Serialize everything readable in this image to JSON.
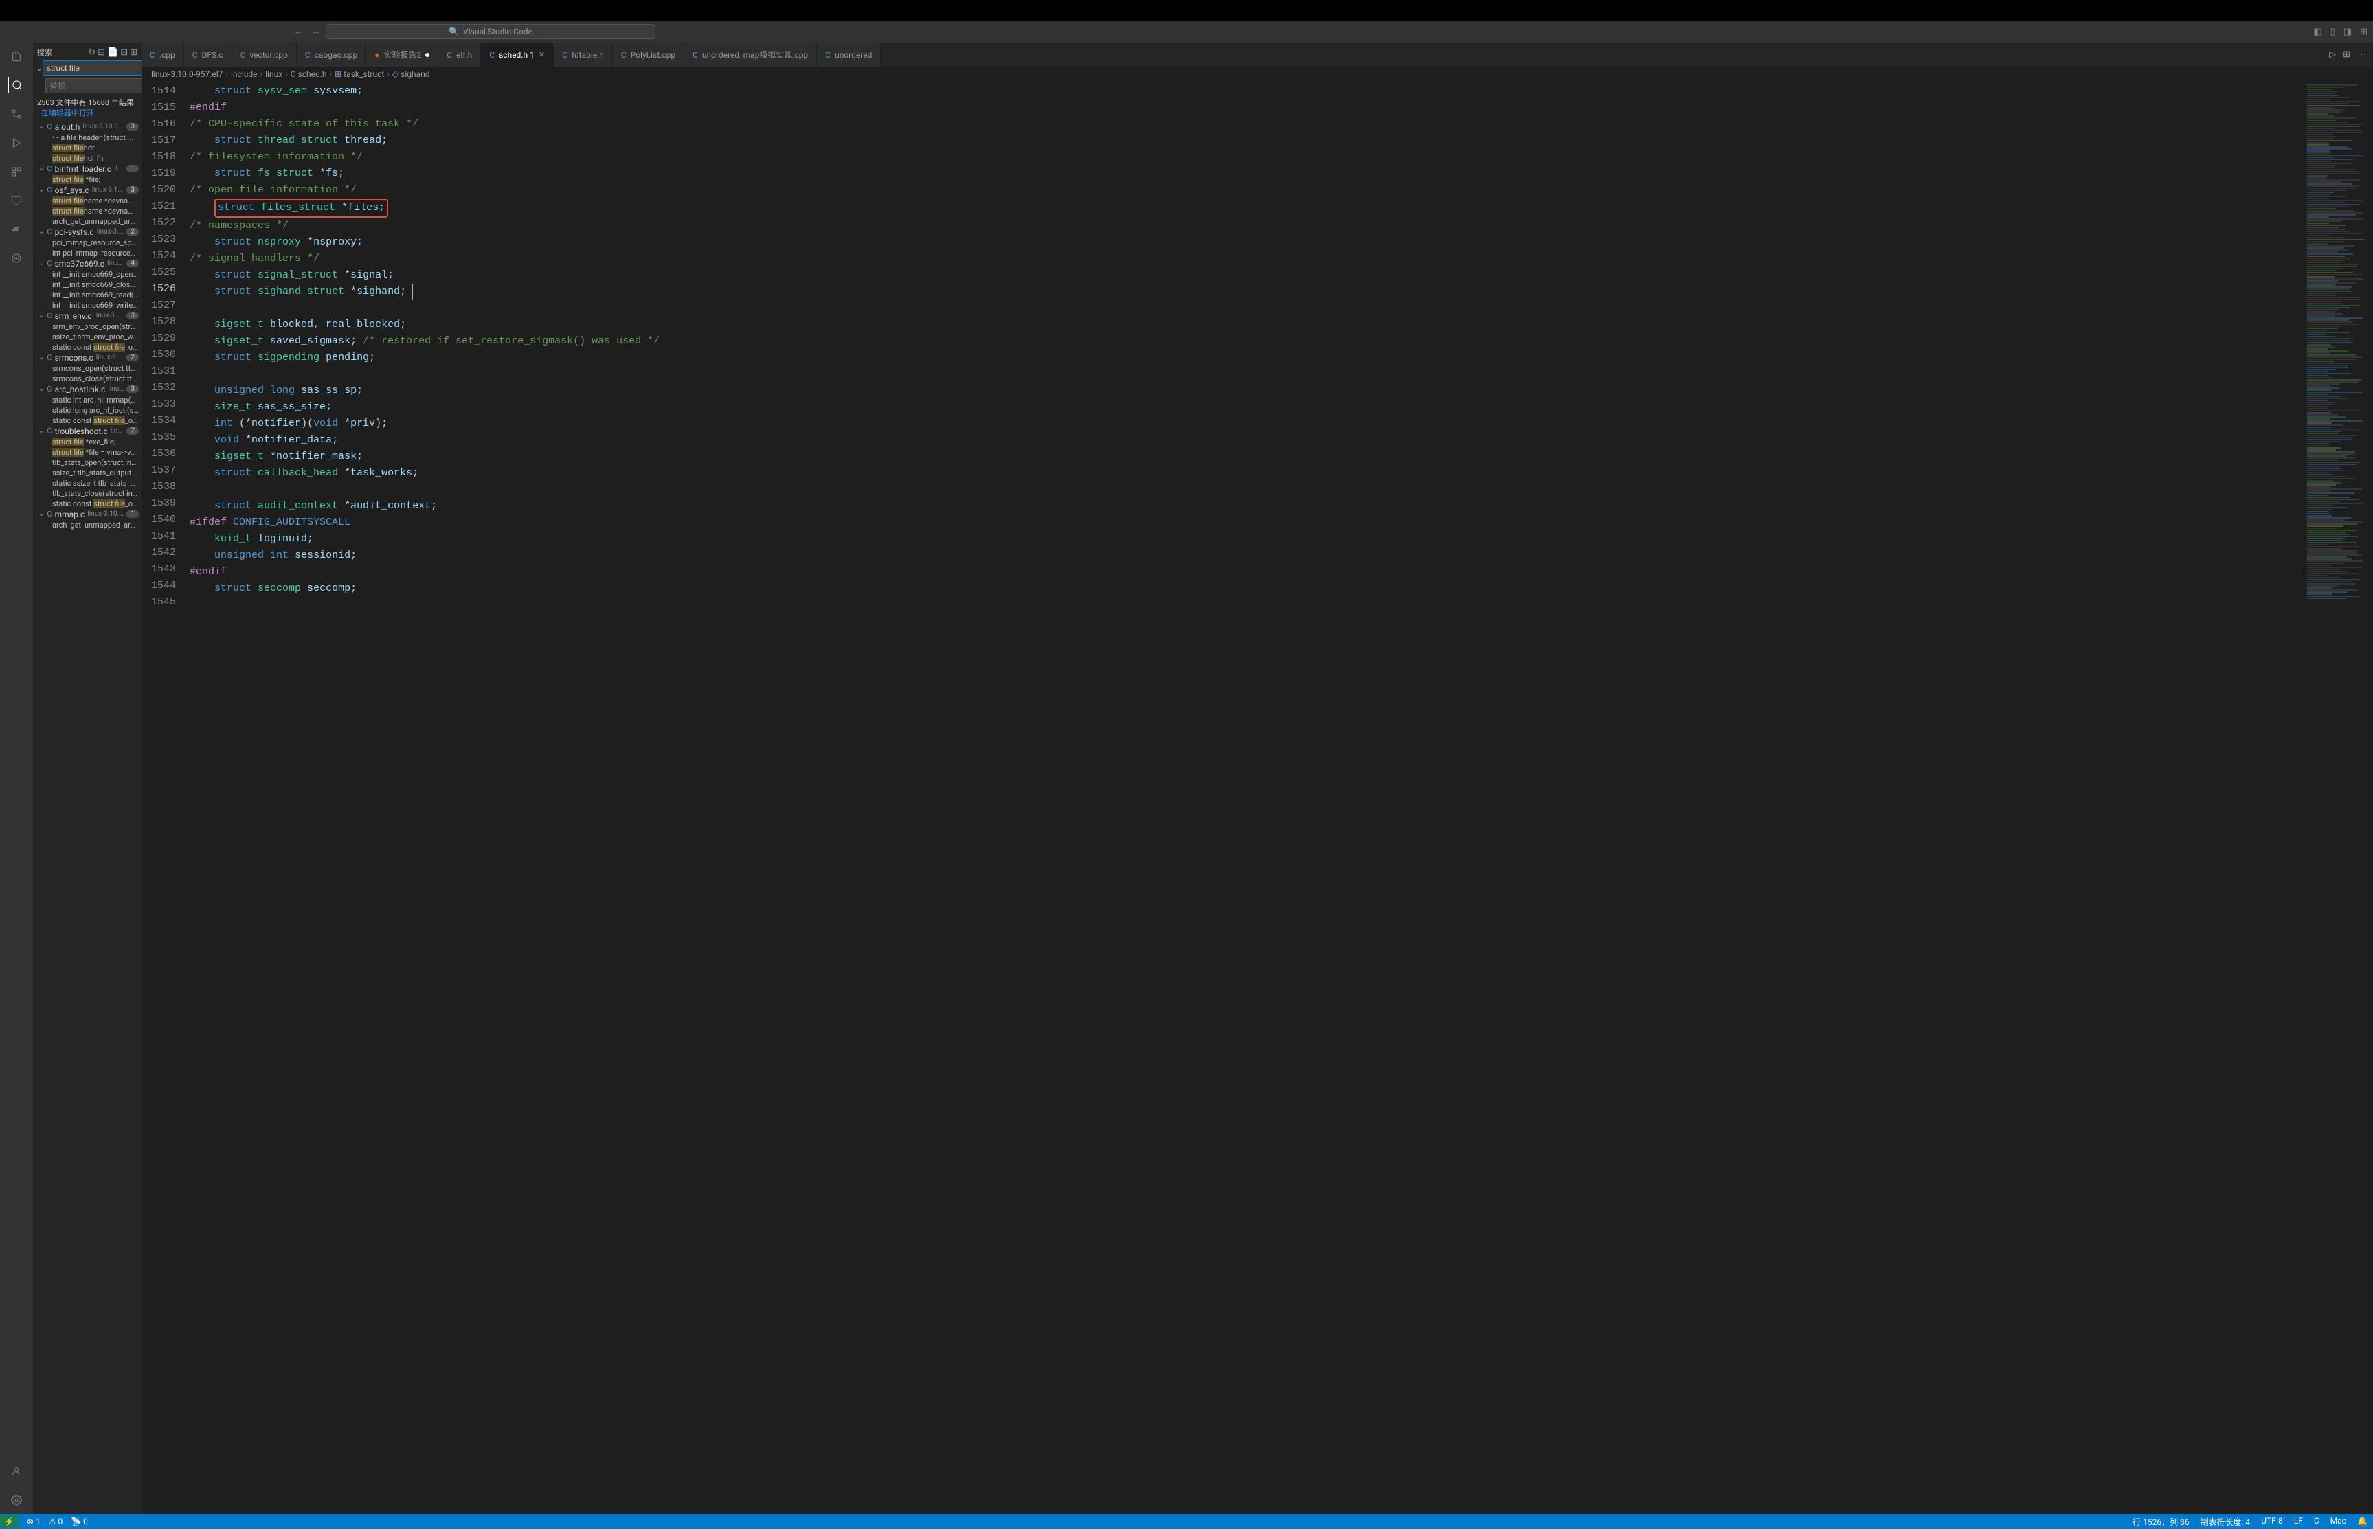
{
  "titlebar": {
    "search_text": "Visual Studio Code"
  },
  "search": {
    "label": "搜索",
    "input_value": "struct file",
    "replace_placeholder": "替换",
    "results_text_1": "2503 文件中有 16688 个结果 - ",
    "results_link": "在编辑器中打开",
    "files": [
      {
        "name": "a.out.h",
        "path": "linux-3.10.0-...",
        "count": "3",
        "lines": [
          "•    - a file header (struct ...",
          "<hl>struct file</hl>hdr",
          "<hl>struct file</hl>hdr      fh;"
        ]
      },
      {
        "name": "binfmt_loader.c",
        "path": "lin...",
        "count": "1",
        "lines": [
          "<hl>struct file</hl> *file;"
        ]
      },
      {
        "name": "osf_sys.c",
        "path": "linux-3.10...",
        "count": "3",
        "lines": [
          "<hl>struct file</hl>name *devname;",
          "<hl>struct file</hl>name *devname;",
          "arch_get_unmapped_area(..."
        ]
      },
      {
        "name": "pci-sysfs.c",
        "path": "linux-3.1...",
        "count": "2",
        "lines": [
          "pci_mmap_resource_spar...",
          "int pci_mmap_resource_d..."
        ]
      },
      {
        "name": "smc37c669.c",
        "path": "linux-3....",
        "count": "4",
        "lines": [
          "int __init smcc669_open( ...",
          "int __init smcc669_close( ...",
          "int __init smcc669_read( ...",
          "int __init smcc669_write( s..."
        ]
      },
      {
        "name": "srm_env.c",
        "path": "linux-3.1...",
        "count": "3",
        "lines": [
          "srm_env_proc_open(struct...",
          "ssize_t srm_env_proc_writ...",
          "static const <hl>struct file</hl>_ope..."
        ]
      },
      {
        "name": "srmcons.c",
        "path": "linux-3.1...",
        "count": "2",
        "lines": [
          "srmcons_open(struct tty_s...",
          "srmcons_close(struct tty_..."
        ]
      },
      {
        "name": "arc_hostlink.c",
        "path": "linux...",
        "count": "3",
        "lines": [
          "static int arc_hl_mmap(str...",
          "static long arc_hl_ioctl(str...",
          "static const <hl>struct file</hl>_ope..."
        ]
      },
      {
        "name": "troubleshoot.c",
        "path": "linux...",
        "count": "7",
        "lines": [
          "<hl>struct file</hl> *exe_file;",
          "<hl>struct file</hl> *file = vma->vm...",
          "tlb_stats_open(struct inod...",
          "ssize_t tlb_stats_output(st...",
          "static ssize_t tlb_stats_cle...",
          "tlb_stats_close(struct inod...",
          "static const <hl>struct file</hl>_ope..."
        ]
      },
      {
        "name": "mmap.c",
        "path": "linux-3.10.0...",
        "count": "1",
        "lines": [
          "arch_get_unmapped_area(..."
        ]
      }
    ]
  },
  "tabs": [
    {
      "label": ".cpp",
      "icon": "cpp",
      "active": false,
      "trunc": true
    },
    {
      "label": "DFS.c",
      "icon": "c",
      "active": false
    },
    {
      "label": "vector.cpp",
      "icon": "cpp",
      "active": false
    },
    {
      "label": "caogao.cpp",
      "icon": "cpp",
      "active": false
    },
    {
      "label": "实验报告2",
      "icon": "txt",
      "active": false,
      "dirty": true
    },
    {
      "label": "elf.h",
      "icon": "c",
      "active": false
    },
    {
      "label": "sched.h 1",
      "icon": "c",
      "active": true,
      "close": true
    },
    {
      "label": "fdtable.h",
      "icon": "c",
      "active": false
    },
    {
      "label": "PolyList.cpp",
      "icon": "cpp",
      "active": false
    },
    {
      "label": "unordered_map模拟实现.cpp",
      "icon": "cpp",
      "active": false
    },
    {
      "label": "unordered",
      "icon": "cpp",
      "active": false,
      "trunc": true
    }
  ],
  "breadcrumbs": [
    {
      "text": "linux-3.10.0-957.el7",
      "icon": ""
    },
    {
      "text": "include",
      "icon": ""
    },
    {
      "text": "linux",
      "icon": ""
    },
    {
      "text": "sched.h",
      "icon": "C"
    },
    {
      "text": "task_struct",
      "icon": "struct"
    },
    {
      "text": "sighand",
      "icon": "field"
    }
  ],
  "line_numbers": [
    "1514",
    "1515",
    "1516",
    "1517",
    "1518",
    "1519",
    "1520",
    "1521",
    "1522",
    "1523",
    "1524",
    "1525",
    "1526",
    "1527",
    "1528",
    "1529",
    "1530",
    "1531",
    "1532",
    "1533",
    "1534",
    "1535",
    "1536",
    "1537",
    "1538",
    "1539",
    "1540",
    "1541",
    "1542",
    "1543",
    "1544",
    "1545"
  ],
  "active_line": "1526",
  "code_lines": [
    {
      "indent": "    ",
      "tokens": [
        [
          "struct",
          "st"
        ],
        [
          " ",
          ""
        ],
        [
          "sysv_sem",
          "type"
        ],
        [
          " ",
          ""
        ],
        [
          "sysvsem;",
          "var"
        ]
      ]
    },
    {
      "indent": "",
      "tokens": [
        [
          "#endif",
          "pp"
        ]
      ]
    },
    {
      "indent": "",
      "tokens": [
        [
          "/* CPU-specific state of this task */",
          "cm"
        ]
      ]
    },
    {
      "indent": "    ",
      "tokens": [
        [
          "struct",
          "st"
        ],
        [
          " ",
          ""
        ],
        [
          "thread_struct",
          "type"
        ],
        [
          " ",
          ""
        ],
        [
          "thread;",
          "var"
        ]
      ]
    },
    {
      "indent": "",
      "tokens": [
        [
          "/* filesystem information */",
          "cm"
        ]
      ]
    },
    {
      "indent": "    ",
      "tokens": [
        [
          "struct",
          "st"
        ],
        [
          " ",
          ""
        ],
        [
          "fs_struct",
          "type"
        ],
        [
          " *",
          ""
        ],
        [
          "fs;",
          "var"
        ]
      ]
    },
    {
      "indent": "",
      "tokens": [
        [
          "/* open file information */",
          "cm"
        ]
      ]
    },
    {
      "indent": "    ",
      "box": true,
      "tokens": [
        [
          "struct",
          "st"
        ],
        [
          " ",
          ""
        ],
        [
          "files_struct",
          "type"
        ],
        [
          " *",
          ""
        ],
        [
          "files;",
          "var"
        ]
      ]
    },
    {
      "indent": "",
      "tokens": [
        [
          "/* namespaces */",
          "cm"
        ]
      ]
    },
    {
      "indent": "    ",
      "tokens": [
        [
          "struct",
          "st"
        ],
        [
          " ",
          ""
        ],
        [
          "nsproxy",
          "type"
        ],
        [
          " *",
          ""
        ],
        [
          "nsproxy;",
          "var"
        ]
      ]
    },
    {
      "indent": "",
      "tokens": [
        [
          "/* signal handlers */",
          "cm"
        ]
      ]
    },
    {
      "indent": "    ",
      "tokens": [
        [
          "struct",
          "st"
        ],
        [
          " ",
          ""
        ],
        [
          "signal_struct",
          "type"
        ],
        [
          " *",
          ""
        ],
        [
          "signal;",
          "var"
        ]
      ]
    },
    {
      "indent": "    ",
      "tokens": [
        [
          "struct",
          "st"
        ],
        [
          " ",
          ""
        ],
        [
          "sighand_struct",
          "type"
        ],
        [
          " *",
          ""
        ],
        [
          "sighand;",
          "var"
        ]
      ],
      "cursor": true
    },
    {
      "indent": "",
      "tokens": [
        [
          "",
          ""
        ]
      ]
    },
    {
      "indent": "    ",
      "tokens": [
        [
          "sigset_t",
          "type"
        ],
        [
          " ",
          ""
        ],
        [
          "blocked, real_blocked;",
          "var"
        ]
      ]
    },
    {
      "indent": "    ",
      "tokens": [
        [
          "sigset_t",
          "type"
        ],
        [
          " ",
          ""
        ],
        [
          "saved_sigmask;",
          "var"
        ],
        [
          " ",
          ""
        ],
        [
          "/* restored if set_restore_sigmask() was used */",
          "cm"
        ]
      ]
    },
    {
      "indent": "    ",
      "tokens": [
        [
          "struct",
          "st"
        ],
        [
          " ",
          ""
        ],
        [
          "sigpending",
          "type"
        ],
        [
          " ",
          ""
        ],
        [
          "pending;",
          "var"
        ]
      ]
    },
    {
      "indent": "",
      "tokens": [
        [
          "",
          ""
        ]
      ]
    },
    {
      "indent": "    ",
      "tokens": [
        [
          "unsigned",
          "kw"
        ],
        [
          " ",
          ""
        ],
        [
          "long",
          "kw"
        ],
        [
          " ",
          ""
        ],
        [
          "sas_ss_sp;",
          "var"
        ]
      ]
    },
    {
      "indent": "    ",
      "tokens": [
        [
          "size_t",
          "type"
        ],
        [
          " ",
          ""
        ],
        [
          "sas_ss_size;",
          "var"
        ]
      ]
    },
    {
      "indent": "    ",
      "tokens": [
        [
          "int",
          "kw"
        ],
        [
          " (*",
          ""
        ],
        [
          "notifier",
          "var"
        ],
        [
          ")(",
          ""
        ],
        [
          "void",
          "kw"
        ],
        [
          " *",
          ""
        ],
        [
          "priv",
          "var"
        ],
        [
          ");",
          ""
        ]
      ]
    },
    {
      "indent": "    ",
      "tokens": [
        [
          "void",
          "kw"
        ],
        [
          " *",
          ""
        ],
        [
          "notifier_data;",
          "var"
        ]
      ]
    },
    {
      "indent": "    ",
      "tokens": [
        [
          "sigset_t",
          "type"
        ],
        [
          " *",
          ""
        ],
        [
          "notifier_mask;",
          "var"
        ]
      ]
    },
    {
      "indent": "    ",
      "tokens": [
        [
          "struct",
          "st"
        ],
        [
          " ",
          ""
        ],
        [
          "callback_head",
          "type"
        ],
        [
          " *",
          ""
        ],
        [
          "task_works;",
          "var"
        ]
      ]
    },
    {
      "indent": "",
      "tokens": [
        [
          "",
          ""
        ]
      ]
    },
    {
      "indent": "    ",
      "tokens": [
        [
          "struct",
          "st"
        ],
        [
          " ",
          ""
        ],
        [
          "audit_context",
          "type"
        ],
        [
          " *",
          ""
        ],
        [
          "audit_context;",
          "var"
        ]
      ]
    },
    {
      "indent": "",
      "tokens": [
        [
          "#ifdef",
          "pp"
        ],
        [
          " ",
          ""
        ],
        [
          "CONFIG_AUDITSYSCALL",
          "mac"
        ]
      ]
    },
    {
      "indent": "    ",
      "tokens": [
        [
          "kuid_t",
          "type"
        ],
        [
          " ",
          ""
        ],
        [
          "loginuid;",
          "var"
        ]
      ]
    },
    {
      "indent": "    ",
      "tokens": [
        [
          "unsigned",
          "kw"
        ],
        [
          " ",
          ""
        ],
        [
          "int",
          "kw"
        ],
        [
          " ",
          ""
        ],
        [
          "sessionid;",
          "var"
        ]
      ]
    },
    {
      "indent": "",
      "tokens": [
        [
          "#endif",
          "pp"
        ]
      ]
    },
    {
      "indent": "    ",
      "tokens": [
        [
          "struct",
          "st"
        ],
        [
          " ",
          ""
        ],
        [
          "seccomp",
          "type"
        ],
        [
          " ",
          ""
        ],
        [
          "seccomp;",
          "var"
        ]
      ]
    },
    {
      "indent": "",
      "tokens": [
        [
          "",
          ""
        ]
      ]
    }
  ],
  "statusbar": {
    "errors": "⊗ 1",
    "warnings": "⚠ 0",
    "ports": "📡 0",
    "cursor": "行 1526，列 36",
    "tabsize": "制表符长度: 4",
    "encoding": "UTF-8",
    "eol": "LF",
    "lang": "C",
    "mac": "Mac",
    "bell": "🔔"
  }
}
